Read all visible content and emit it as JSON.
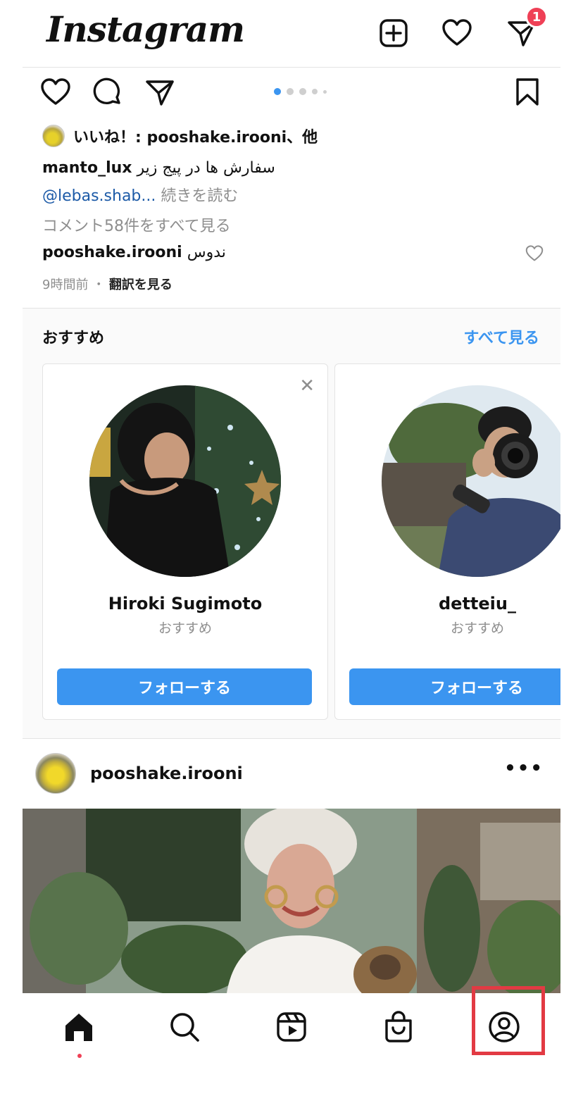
{
  "header": {
    "logo": "Instagram",
    "icons": [
      "add-post-icon",
      "heart-icon",
      "direct-message-icon"
    ],
    "dm_badge": "1"
  },
  "post_actions": {
    "icons": [
      "like-icon",
      "comment-icon",
      "share-icon",
      "bookmark-icon"
    ],
    "carousel_dots": 5,
    "carousel_active": 1
  },
  "likes": {
    "text": "いいね！: pooshake.irooni、他"
  },
  "caption": {
    "user": "manto_lux",
    "text": "سفارش ها در پیج زیر",
    "mention": "@lebas.shab...",
    "more": " 続きを読む"
  },
  "comments": {
    "view_all": "コメント58件をすべて見る",
    "top_comment_user": "pooshake.irooni",
    "top_comment_text": "ندوس"
  },
  "meta": {
    "time": "9時間前",
    "separator": "・",
    "translate": "翻訳を見る"
  },
  "suggestions": {
    "title": "おすすめ",
    "see_all": "すべて見る",
    "cards": [
      {
        "name": "Hiroki  Sugimoto",
        "sub": "おすすめ",
        "button": "フォローする"
      },
      {
        "name": "detteiu_",
        "sub": "おすすめ",
        "button": "フォローする"
      }
    ]
  },
  "post": {
    "user": "pooshake.irooni",
    "more": "•••"
  },
  "bottom_nav": {
    "items": [
      "home-icon",
      "search-icon",
      "reels-icon",
      "shop-icon",
      "profile-icon"
    ],
    "highlighted": "profile-icon"
  },
  "colors": {
    "accent": "#3b95f0",
    "badge": "#ef4056",
    "highlight_box": "#e23a43"
  }
}
